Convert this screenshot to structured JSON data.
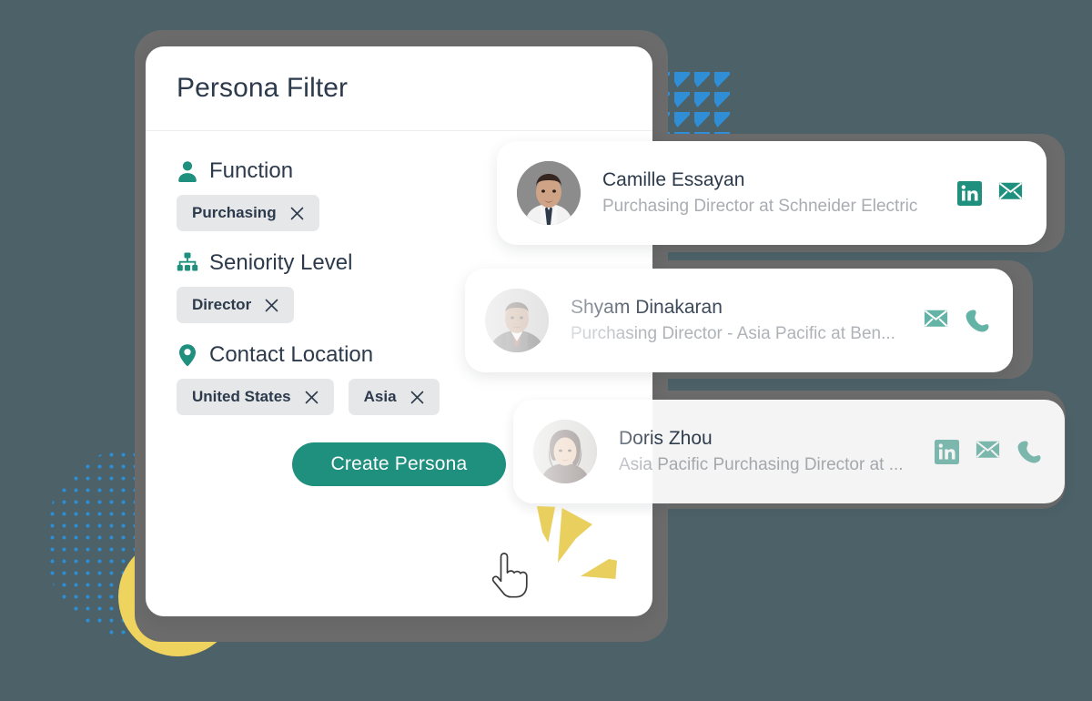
{
  "theme": {
    "background": "#4c6168",
    "backing_card": "#6b6b6b",
    "panel": "#ffffff",
    "accent_green": "#1f8f7e",
    "accent_green_muted": "#7dbdb3",
    "chip_bg": "#e6e7e9",
    "text_dark": "#2c3a4b",
    "text_muted": "#a9adb2",
    "decor_blue": "#2f8ed6",
    "decor_yellow": "#efd35f"
  },
  "panel": {
    "title": "Persona Filter",
    "fields": [
      {
        "icon": "person-icon",
        "label": "Function",
        "chips": [
          {
            "label": "Purchasing",
            "remove_icon": "close-icon"
          }
        ]
      },
      {
        "icon": "org-chart-icon",
        "label": "Seniority Level",
        "chips": [
          {
            "label": "Director",
            "remove_icon": "close-icon"
          }
        ]
      },
      {
        "icon": "map-pin-icon",
        "label": "Contact Location",
        "chips": [
          {
            "label": "United States",
            "remove_icon": "close-icon"
          },
          {
            "label": "Asia",
            "remove_icon": "close-icon"
          }
        ]
      }
    ],
    "cta": {
      "label": "Create Persona",
      "icon": "cursor-pointer-icon"
    }
  },
  "contacts": [
    {
      "name": "Camille Essayan",
      "role": "Purchasing Director at Schneider Electric",
      "avatar_name": "avatar-camille-essayan",
      "actions": [
        "linkedin-icon",
        "email-icon"
      ]
    },
    {
      "name": "Shyam Dinakaran",
      "role": "Purchasing Director - Asia Pacific at Ben...",
      "avatar_name": "avatar-shyam-dinakaran",
      "actions": [
        "email-icon",
        "phone-icon"
      ]
    },
    {
      "name": "Doris Zhou",
      "role": "Asia Pacific Purchasing Director at ...",
      "avatar_name": "avatar-doris-zhou",
      "actions": [
        "linkedin-icon",
        "email-icon",
        "phone-icon"
      ]
    }
  ],
  "decorations": {
    "triangle_grid": {
      "icon": "triangle-pattern",
      "rows": 4,
      "cols": 4,
      "color": "#2f8ed6"
    },
    "dot_circle": {
      "icon": "dot-pattern-circle",
      "color": "#2b8fd8"
    },
    "yellow_circle": {
      "icon": "circle-shape",
      "color": "#efd35f"
    },
    "sparkle": {
      "icon": "sparkle-burst-icon",
      "color": "#e8cf5e"
    }
  }
}
